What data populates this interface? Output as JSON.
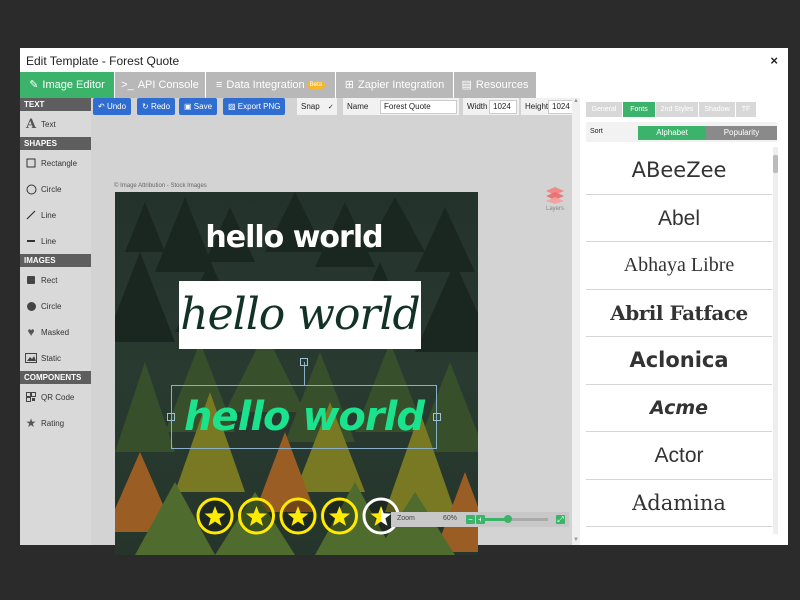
{
  "window": {
    "title": "Edit Template - Forest Quote",
    "close": "×"
  },
  "tabs": [
    {
      "icon": "✎",
      "label": "Image Editor",
      "badge": ""
    },
    {
      "icon": ">_",
      "label": "API Console",
      "badge": ""
    },
    {
      "icon": "≡",
      "label": "Data Integration",
      "badge": "Beta"
    },
    {
      "icon": "⊞",
      "label": "Zapier Integration",
      "badge": ""
    },
    {
      "icon": "▤",
      "label": "Resources",
      "badge": ""
    }
  ],
  "sidebar": {
    "sections": {
      "text": "TEXT",
      "shapes": "SHAPES",
      "images": "IMAGES",
      "components": "COMPONENTS"
    },
    "items": {
      "text": "Text",
      "rectangle": "Rectangle",
      "circle": "Circle",
      "line1": "Line",
      "line2": "Line",
      "rect": "Rect",
      "img_circle": "Circle",
      "masked": "Masked",
      "static": "Static",
      "qr": "QR Code",
      "rating": "Rating"
    }
  },
  "toolbar": {
    "undo": "Undo",
    "redo": "Redo",
    "save": "Save",
    "export": "Export PNG",
    "snap_label": "Snap",
    "snap_checked": "✓",
    "name_label": "Name",
    "name_value": "Forest Quote",
    "width_label": "Width",
    "width_value": "1024",
    "height_label": "Height",
    "height_value": "1024"
  },
  "canvas": {
    "attribution": "© Image Attribution - Stock Images",
    "text1": "hello world",
    "text2": "hello world",
    "text3": "hello world",
    "rating_stars": 4.5,
    "rating_max": 5
  },
  "layers_label": "Layers",
  "zoom": {
    "label": "Zoom",
    "value": "60%",
    "minus": "−",
    "plus": "+",
    "level": 0.4
  },
  "panel": {
    "tabs": [
      "General",
      "Fonts",
      "2nd Styles",
      "Shadow",
      "TF"
    ],
    "sort_label": "Sort",
    "sort_options": [
      "Alphabet",
      "Popularity"
    ],
    "fonts": [
      "ABeeZee",
      "Abel",
      "Abhaya Libre",
      "Abril Fatface",
      "Aclonica",
      "Acme",
      "Actor",
      "Adamina"
    ]
  },
  "colors": {
    "accent": "#3bb36a",
    "button_blue": "#2f6dd1",
    "text1": "#ffffff",
    "text2": "#123228",
    "text3": "#1be28d",
    "star": "#ffea00"
  }
}
